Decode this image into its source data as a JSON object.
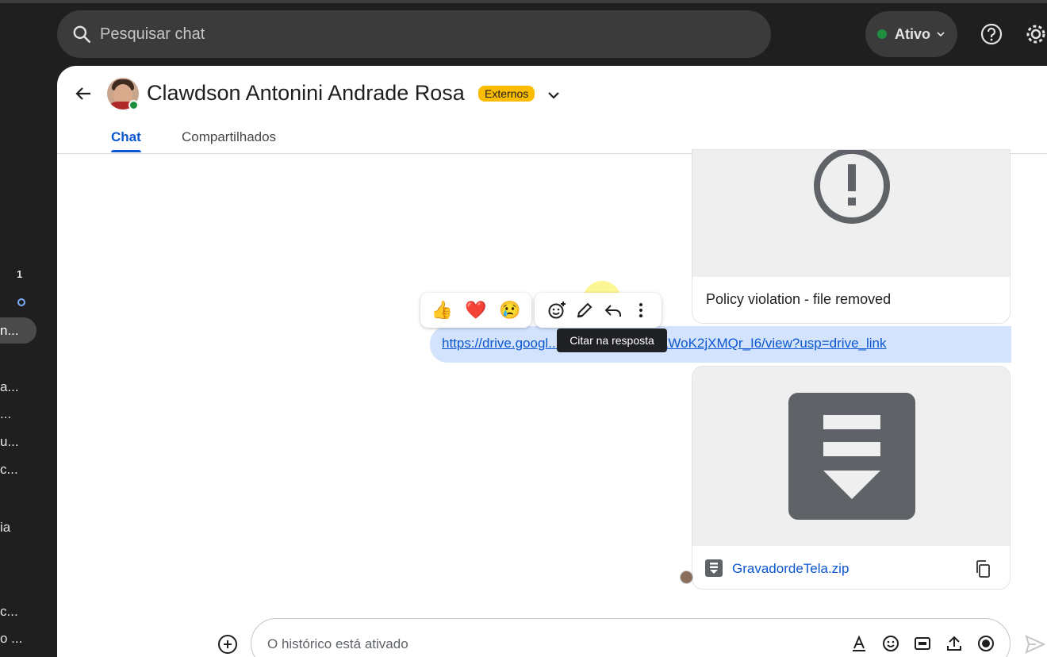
{
  "search": {
    "placeholder": "Pesquisar chat"
  },
  "status": {
    "label": "Ativo",
    "color": "#1e8e3e"
  },
  "sidebar": {
    "badge": "1",
    "items": [
      "n...",
      "a...",
      "...",
      "u...",
      "c...",
      "ia",
      "c...",
      "o ..."
    ]
  },
  "header": {
    "contact_name": "Clawdson Antonini Andrade Rosa",
    "badge": "Externos",
    "tabs": [
      {
        "label": "Chat"
      },
      {
        "label": "Compartilhados"
      }
    ]
  },
  "messages": {
    "policy_caption": "Policy violation - file removed",
    "link": "https://drive.googl...f8hhzEnI3asCxRaWoK2jXMQr_I6/view?usp=drive_link",
    "attachment_name": "GravadordeTela.zip"
  },
  "reactions": [
    "👍",
    "❤️",
    "😢"
  ],
  "tooltip": "Citar na resposta",
  "composer": {
    "placeholder": "O histórico está ativado"
  },
  "colors": {
    "accent": "#0b57d0",
    "badge": "#fbbc04",
    "dark_bg": "#1f1f1f"
  }
}
